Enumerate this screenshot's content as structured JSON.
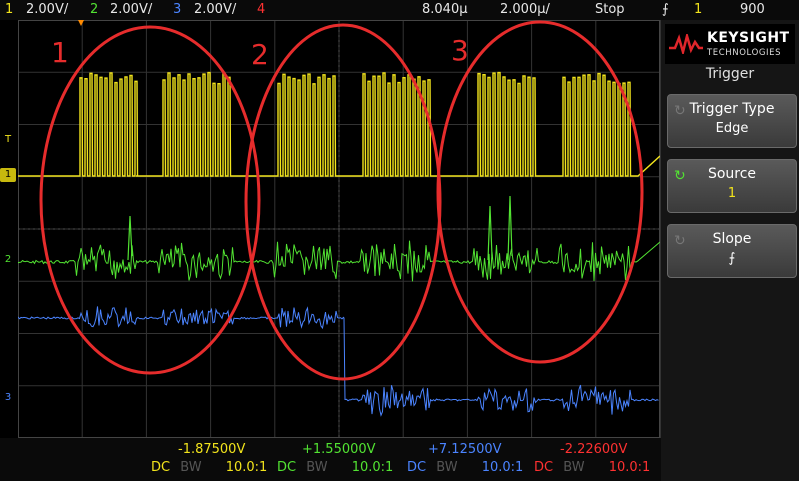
{
  "topbar": {
    "ch1_num": "1",
    "ch1_scale": "2.00V/",
    "ch2_num": "2",
    "ch2_scale": "2.00V/",
    "ch3_num": "3",
    "ch3_scale": "2.00V/",
    "ch4_num": "4",
    "time_delay": "8.040µ",
    "time_scale": "2.000µ/",
    "run_state": "Stop",
    "trigger_slope_icon": "falling-edge-icon",
    "trigger_source": "1",
    "trigger_level": "900"
  },
  "annotations": [
    "1",
    "2",
    "3"
  ],
  "markers": {
    "trigger": "T",
    "ch1": "1",
    "ch2": "2",
    "ch3": "3"
  },
  "panel": {
    "brand": "KEYSIGHT",
    "brand_sub": "TECHNOLOGIES",
    "menu_title": "Trigger",
    "softkeys": [
      {
        "label": "Trigger Type",
        "value": "Edge"
      },
      {
        "label": "Source",
        "value": "1"
      },
      {
        "label": "Slope",
        "value": "⨍"
      }
    ]
  },
  "bottom": {
    "offsets": [
      "-1.87500V",
      "+1.55000V",
      "+7.12500V",
      "-2.22600V"
    ],
    "channels": [
      {
        "coupling": "DC",
        "bw": "BW",
        "probe": "10.0:1"
      },
      {
        "coupling": "DC",
        "bw": "BW",
        "probe": "10.0:1"
      },
      {
        "coupling": "DC",
        "bw": "BW",
        "probe": "10.0:1"
      },
      {
        "coupling": "DC",
        "bw": "BW",
        "probe": "10.0:1"
      }
    ]
  },
  "colors": {
    "ch1": "#f2e41c",
    "ch2": "#52e332",
    "ch3": "#4b84ff",
    "ch4": "#ff3131",
    "annotation": "#e62c2c"
  }
}
